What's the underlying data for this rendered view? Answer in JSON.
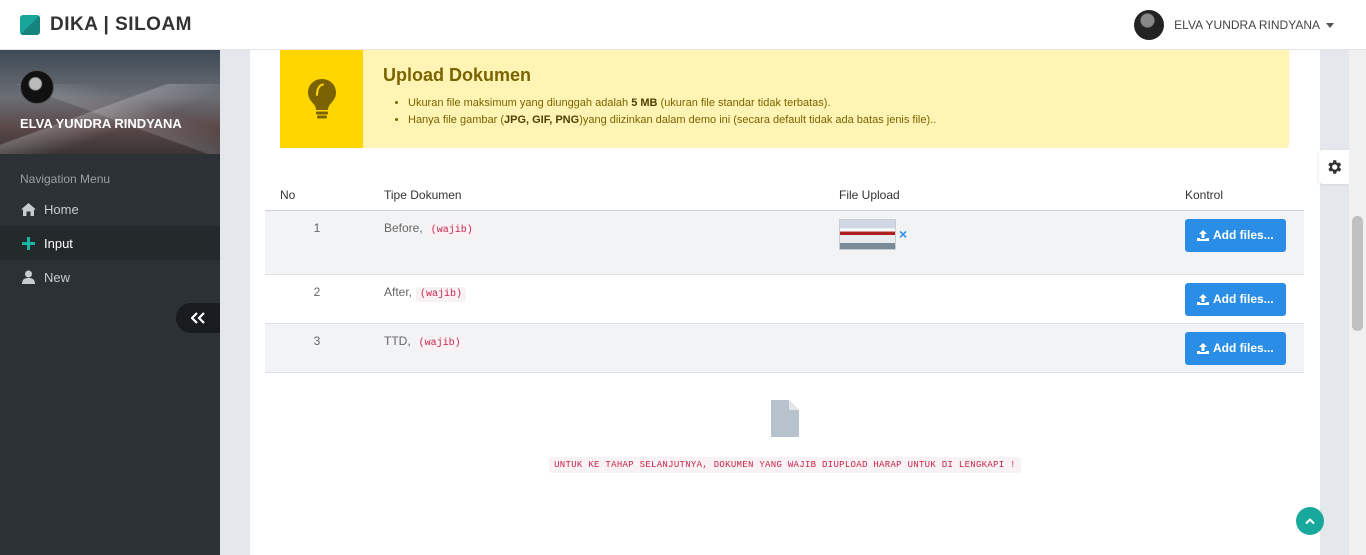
{
  "app": {
    "title": "DIKA | SILOAM"
  },
  "topbar": {
    "user_name": "ELVA YUNDRA RINDYANA",
    "icons": [
      "brand-logo",
      "avatar",
      "caret-down-icon"
    ]
  },
  "sidebar": {
    "user_name": "ELVA YUNDRA RINDYANA",
    "nav_header": "Navigation Menu",
    "items": [
      {
        "label": "Home",
        "icon": "home-icon",
        "active": false
      },
      {
        "label": "Input",
        "icon": "plus-icon",
        "active": true
      },
      {
        "label": "New",
        "icon": "user-icon",
        "active": false
      }
    ],
    "collapse_icon": "double-chevron-left-icon"
  },
  "callout": {
    "title": "Upload Dokumen",
    "icon": "lightbulb-icon",
    "line1_pre": "Ukuran file maksimum yang diunggah adalah ",
    "line1_bold": "5 MB",
    "line1_post": " (ukuran file standar tidak terbatas).",
    "line2_pre": "Hanya file gambar (",
    "line2_bold": "JPG, GIF, PNG",
    "line2_post": ")yang diizinkan dalam demo ini (secara default tidak ada batas jenis file).."
  },
  "table": {
    "headers": {
      "no": "No",
      "tipe": "Tipe Dokumen",
      "file": "File Upload",
      "kontrol": "Kontrol"
    },
    "rows": [
      {
        "no": "1",
        "tipe": "Before,",
        "tag": "(wajib)",
        "has_file": true,
        "file_remove": "×",
        "button": "Add files..."
      },
      {
        "no": "2",
        "tipe": "After,",
        "tag": "(wajib)",
        "has_file": false,
        "button": "Add files..."
      },
      {
        "no": "3",
        "tipe": "TTD,",
        "tag": "(wajib)",
        "has_file": false,
        "button": "Add files..."
      }
    ]
  },
  "empty_state": {
    "icon": "document-icon",
    "message": "UNTUK KE TAHAP SELANJUTNYA, DOKUMEN YANG WAJIB DIUPLOAD HARAP UNTUK DI LENGKAPI !"
  },
  "widgets": {
    "settings_icon": "gear-icon",
    "back_to_top_icon": "chevron-up-icon"
  },
  "colors": {
    "accent": "#19a99c",
    "button": "#2a8ee6",
    "callout_bg": "#fff4b3",
    "callout_icon_bg": "#ffd600",
    "sidebar_bg": "#2b3135"
  }
}
